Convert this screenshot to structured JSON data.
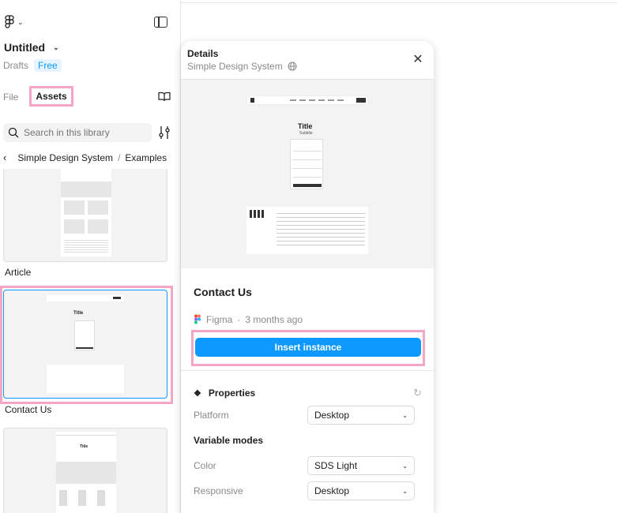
{
  "sidebar": {
    "file_title": "Untitled",
    "drafts_label": "Drafts",
    "plan_badge": "Free",
    "tabs": [
      {
        "label": "File"
      },
      {
        "label": "Assets"
      }
    ],
    "search_placeholder": "Search in this library",
    "breadcrumb": {
      "library": "Simple Design System",
      "separator": "/",
      "folder": "Examples"
    },
    "cards": [
      {
        "label": "Article"
      },
      {
        "label": "Contact Us"
      },
      {
        "label": ""
      }
    ]
  },
  "details": {
    "header_title": "Details",
    "library_name": "Simple Design System",
    "component_name": "Contact Us",
    "author": "Figma",
    "updated": "3 months ago",
    "meta_separator": "·",
    "insert_button": "Insert instance",
    "properties_heading": "Properties",
    "platform_label": "Platform",
    "platform_value": "Desktop",
    "variable_modes_heading": "Variable modes",
    "color_label": "Color",
    "color_value": "SDS Light",
    "responsive_label": "Responsive",
    "responsive_value": "Desktop",
    "preview": {
      "title": "Title",
      "subtitle": "Subtitle"
    }
  },
  "colors": {
    "accent": "#0d99ff",
    "highlight": "#f4a6c4"
  }
}
